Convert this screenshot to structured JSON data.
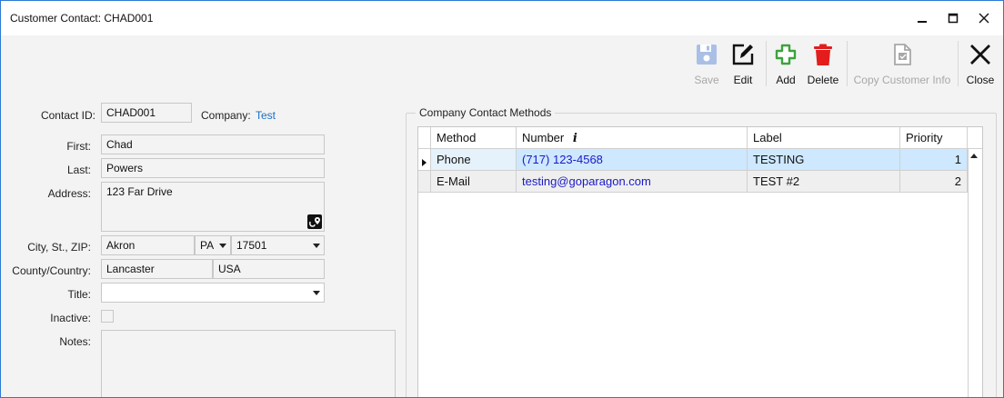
{
  "window": {
    "title": "Customer Contact: CHAD001"
  },
  "controls": {
    "minimize": "—",
    "maximize": "☐",
    "close": "✕"
  },
  "toolbar": {
    "save": "Save",
    "edit": "Edit",
    "add": "Add",
    "delete": "Delete",
    "copy_info": "Copy Customer Info",
    "close": "Close"
  },
  "form": {
    "contact_id_label": "Contact ID:",
    "contact_id": "CHAD001",
    "company_label": "Company:",
    "company": "Test",
    "first_label": "First:",
    "first": "Chad",
    "last_label": "Last:",
    "last": "Powers",
    "address_label": "Address:",
    "address": "123 Far Drive",
    "city_label": "City, St., ZIP:",
    "city": "Akron",
    "state": "PA",
    "zip": "17501",
    "county_label": "County/Country:",
    "county": "Lancaster",
    "country": "USA",
    "title_label": "Title:",
    "title": "",
    "inactive_label": "Inactive:",
    "inactive": false,
    "notes_label": "Notes:",
    "notes": ""
  },
  "contact_methods": {
    "group_title": "Company Contact Methods",
    "columns": [
      "Method",
      "Number",
      "Label",
      "Priority"
    ],
    "number_info_glyph": "i",
    "rows": [
      {
        "method": "Phone",
        "number": "(717) 123-4568",
        "label": "TESTING",
        "priority": "1"
      },
      {
        "method": "E-Mail",
        "number": "testing@goparagon.com",
        "label": "TEST #2",
        "priority": "2"
      }
    ]
  },
  "colors": {
    "accent": "#2b79d6",
    "add_green": "#3ba33b",
    "delete_red": "#e51c1c",
    "selected_row": "#cde8ff",
    "link_blue": "#1a6fc4"
  },
  "icons": {
    "save": "floppy-disk-icon",
    "edit": "pencil-square-icon",
    "add": "plus-icon",
    "delete": "trash-can-icon",
    "copy_info": "document-copy-icon",
    "close": "x-icon",
    "map": "map-pin-icon"
  }
}
